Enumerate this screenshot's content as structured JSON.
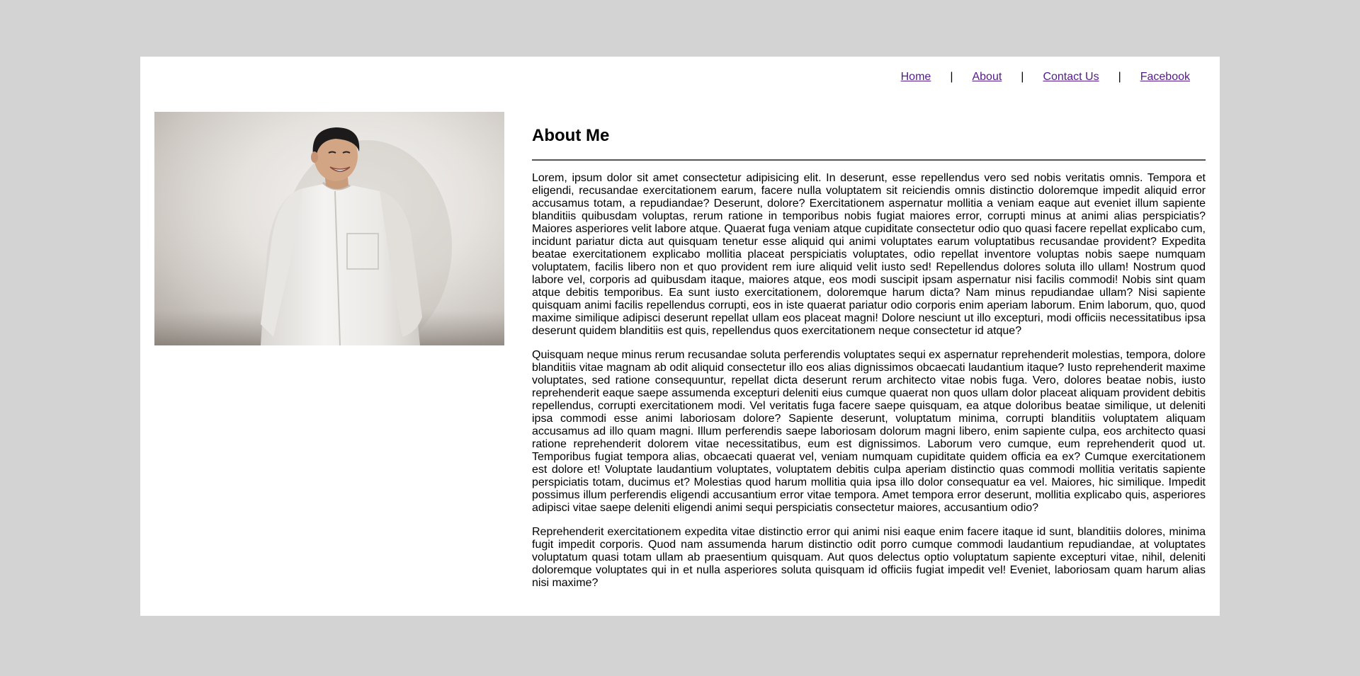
{
  "nav": {
    "items": [
      {
        "label": "Home"
      },
      {
        "label": "About"
      },
      {
        "label": "Contact Us"
      },
      {
        "label": "Facebook"
      }
    ],
    "separator": "|"
  },
  "profile_photo": {
    "subject": "smiling man in a white button-up shirt against a light grey wall"
  },
  "about": {
    "title": "About Me",
    "paragraphs": [
      "Lorem, ipsum dolor sit amet consectetur adipisicing elit. In deserunt, esse repellendus vero sed nobis veritatis omnis. Tempora et eligendi, recusandae exercitationem earum, facere nulla voluptatem sit reiciendis omnis distinctio doloremque impedit aliquid error accusamus totam, a repudiandae? Deserunt, dolore? Exercitationem aspernatur mollitia a veniam eaque aut eveniet illum sapiente blanditiis quibusdam voluptas, rerum ratione in temporibus nobis fugiat maiores error, corrupti minus at animi alias perspiciatis? Maiores asperiores velit labore atque. Quaerat fuga veniam atque cupiditate consectetur odio quo quasi facere repellat explicabo cum, incidunt pariatur dicta aut quisquam tenetur esse aliquid qui animi voluptates earum voluptatibus recusandae provident? Expedita beatae exercitationem explicabo mollitia placeat perspiciatis voluptates, odio repellat inventore voluptas nobis saepe numquam voluptatem, facilis libero non et quo provident rem iure aliquid velit iusto sed! Repellendus dolores soluta illo ullam! Nostrum quod labore vel, corporis ad quibusdam itaque, maiores atque, eos modi suscipit ipsam aspernatur nisi facilis commodi! Nobis sint quam atque debitis temporibus. Ea sunt iusto exercitationem, doloremque harum dicta? Nam minus repudiandae ullam? Nisi sapiente quisquam animi facilis repellendus corrupti, eos in iste quaerat pariatur odio corporis enim aperiam laborum. Enim laborum, quo, quod maxime similique adipisci deserunt repellat ullam eos placeat magni! Dolore nesciunt ut illo excepturi, modi officiis necessitatibus ipsa deserunt quidem blanditiis est quis, repellendus quos exercitationem neque consectetur id atque?",
      "Quisquam neque minus rerum recusandae soluta perferendis voluptates sequi ex aspernatur reprehenderit molestias, tempora, dolore blanditiis vitae magnam ab odit aliquid consectetur illo eos alias dignissimos obcaecati laudantium itaque? Iusto reprehenderit maxime voluptates, sed ratione consequuntur, repellat dicta deserunt rerum architecto vitae nobis fuga. Vero, dolores beatae nobis, iusto reprehenderit eaque saepe assumenda excepturi deleniti eius cumque quaerat non quos ullam dolor placeat aliquam provident debitis repellendus, corrupti exercitationem modi. Vel veritatis fuga facere saepe quisquam, ea atque doloribus beatae similique, ut deleniti ipsa commodi esse animi laboriosam dolore? Sapiente deserunt, voluptatum minima, corrupti blanditiis voluptatem aliquam accusamus ad illo quam magni. Illum perferendis saepe laboriosam dolorum magni libero, enim sapiente culpa, eos architecto quasi ratione reprehenderit dolorem vitae necessitatibus, eum est dignissimos. Laborum vero cumque, eum reprehenderit quod ut. Temporibus fugiat tempora alias, obcaecati quaerat vel, veniam numquam cupiditate quidem officia ea ex? Cumque exercitationem est dolore et! Voluptate laudantium voluptates, voluptatem debitis culpa aperiam distinctio quas commodi mollitia veritatis sapiente perspiciatis totam, ducimus et? Molestias quod harum mollitia quia ipsa illo dolor consequatur ea vel. Maiores, hic similique. Impedit possimus illum perferendis eligendi accusantium error vitae tempora. Amet tempora error deserunt, mollitia explicabo quis, asperiores adipisci vitae saepe deleniti eligendi animi sequi perspiciatis consectetur maiores, accusantium odio?",
      "Reprehenderit exercitationem expedita vitae distinctio error qui animi nisi eaque enim facere itaque id sunt, blanditiis dolores, minima fugit impedit corporis. Quod nam assumenda harum distinctio odit porro cumque commodi laudantium repudiandae, at voluptates voluptatum quasi totam ullam ab praesentium quisquam. Aut quos delectus optio voluptatum sapiente excepturi vitae, nihil, deleniti doloremque voluptates qui in et nulla asperiores soluta quisquam id officiis fugiat impedit vel! Eveniet, laboriosam quam harum alias nisi maxime?"
    ]
  }
}
